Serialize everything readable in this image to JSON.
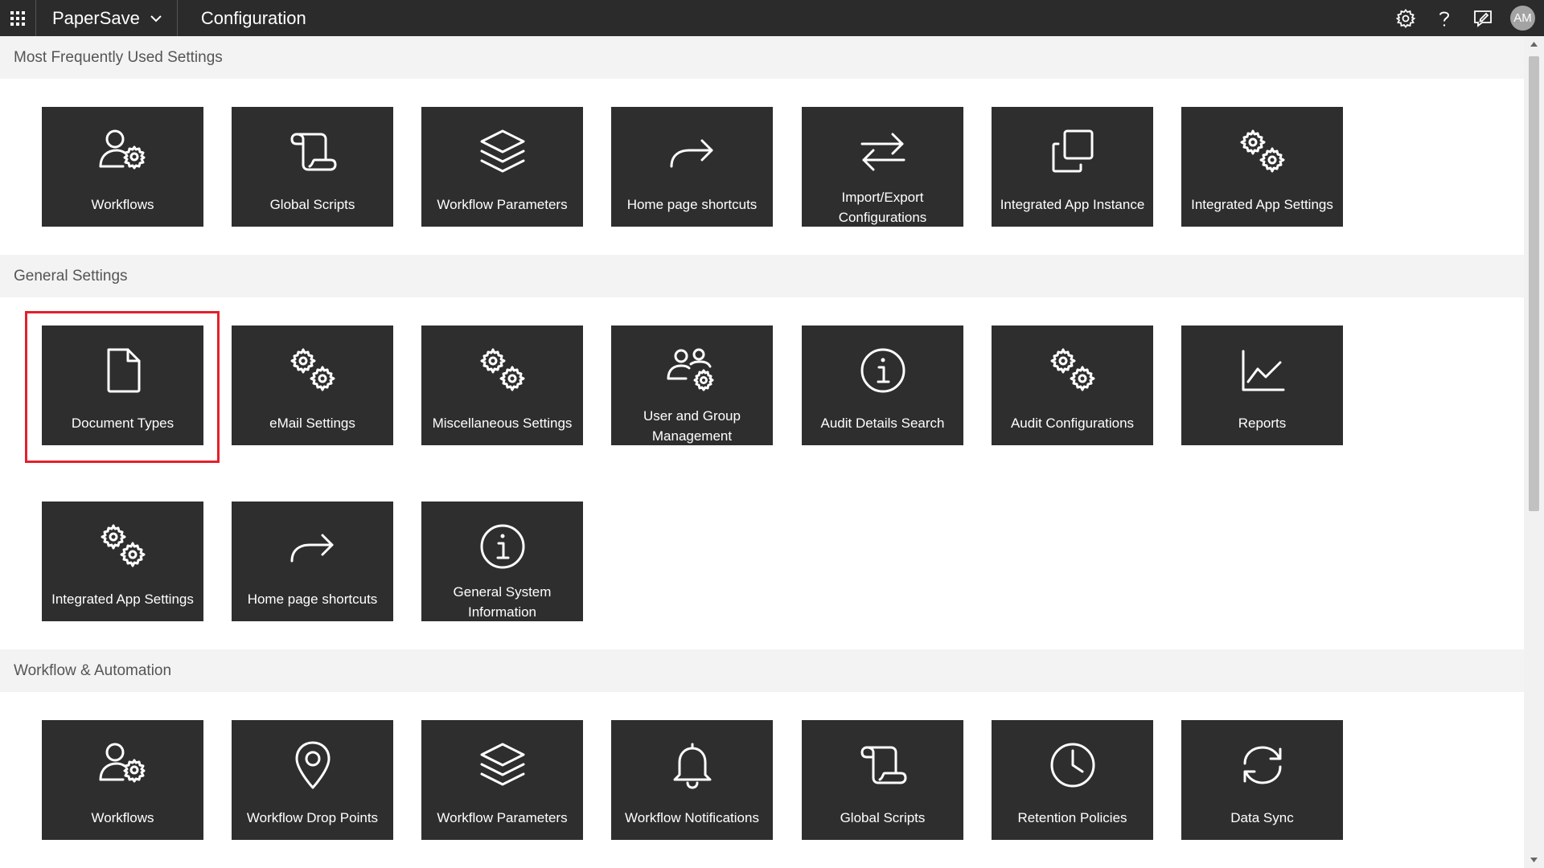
{
  "app": {
    "name": "PaperSave",
    "page_title": "Configuration",
    "user_initials": "AM"
  },
  "toolbar_icons": [
    "gear-icon",
    "help-icon",
    "feedback-icon"
  ],
  "sections": [
    {
      "title": "Most Frequently Used Settings",
      "tiles": [
        {
          "label": "Workflows",
          "icon": "user-gear-icon"
        },
        {
          "label": "Global Scripts",
          "icon": "scroll-icon"
        },
        {
          "label": "Workflow Parameters",
          "icon": "layers-icon"
        },
        {
          "label": "Home page shortcuts",
          "icon": "arrow-forward-icon"
        },
        {
          "label": "Import/Export Configurations",
          "icon": "swap-arrows-icon"
        },
        {
          "label": "Integrated App Instance",
          "icon": "copy-icon"
        },
        {
          "label": "Integrated App Settings",
          "icon": "gears-icon"
        }
      ]
    },
    {
      "title": "General Settings",
      "tiles": [
        {
          "label": "Document Types",
          "icon": "document-icon"
        },
        {
          "label": "eMail Settings",
          "icon": "gears-icon"
        },
        {
          "label": "Miscellaneous Settings",
          "icon": "gears-icon"
        },
        {
          "label": "User and Group Management",
          "icon": "users-gear-icon"
        },
        {
          "label": "Audit Details Search",
          "icon": "info-icon"
        },
        {
          "label": "Audit Configurations",
          "icon": "gears-icon"
        },
        {
          "label": "Reports",
          "icon": "line-chart-icon"
        },
        {
          "label": "Integrated App Settings",
          "icon": "gears-icon"
        },
        {
          "label": "Home page shortcuts",
          "icon": "arrow-forward-icon"
        },
        {
          "label": "General System Information",
          "icon": "info-icon"
        }
      ]
    },
    {
      "title": "Workflow & Automation",
      "tiles": [
        {
          "label": "Workflows",
          "icon": "user-gear-icon"
        },
        {
          "label": "Workflow Drop Points",
          "icon": "map-pin-icon"
        },
        {
          "label": "Workflow Parameters",
          "icon": "layers-icon"
        },
        {
          "label": "Workflow Notifications",
          "icon": "bell-icon"
        },
        {
          "label": "Global Scripts",
          "icon": "scroll-icon"
        },
        {
          "label": "Retention Policies",
          "icon": "clock-icon"
        },
        {
          "label": "Data Sync",
          "icon": "sync-icon"
        }
      ]
    }
  ],
  "highlighted_tile": "Document Types",
  "colors": {
    "topbar": "#2b2b2b",
    "tile": "#2e2e2e",
    "section_header_bg": "#f3f3f3",
    "highlight": "#e3202b"
  }
}
